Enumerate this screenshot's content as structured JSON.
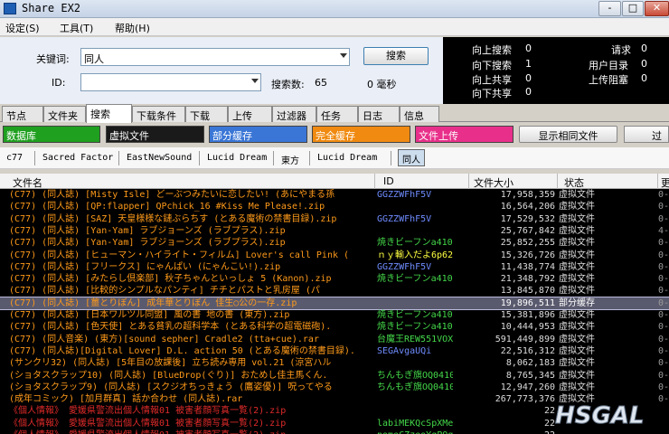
{
  "window": {
    "title": "Share EX2",
    "minimize": "-",
    "maximize": "□",
    "close": "✕"
  },
  "menu": [
    {
      "label": "设定(S)"
    },
    {
      "label": "工具(T)"
    },
    {
      "label": "帮助(H)"
    }
  ],
  "search": {
    "keyword_label": "关键词:",
    "keyword_value": "同人",
    "id_label": "ID:",
    "id_value": "",
    "search_button": "搜索",
    "result_count_label": "搜索数:",
    "result_count": "65",
    "elapsed": "0 毫秒"
  },
  "stats": [
    {
      "label": "向上搜索",
      "value": "0"
    },
    {
      "label": "向下搜索",
      "value": "1"
    },
    {
      "label": "向上共享",
      "value": "0"
    },
    {
      "label": "向下共享",
      "value": "0"
    },
    {
      "label": "请求",
      "value": "0"
    },
    {
      "label": "用户目录",
      "value": "0"
    },
    {
      "label": "上传阻塞",
      "value": "0"
    }
  ],
  "tabs": [
    {
      "label": "节点"
    },
    {
      "label": "文件夹"
    },
    {
      "label": "搜索"
    },
    {
      "label": "下载条件"
    },
    {
      "label": "下载"
    },
    {
      "label": "上传"
    },
    {
      "label": "过滤器"
    },
    {
      "label": "任务"
    },
    {
      "label": "日志"
    },
    {
      "label": "信息"
    }
  ],
  "filters": [
    {
      "label": "数据库",
      "color": "#1fa01f",
      "text": "#ffffff"
    },
    {
      "label": "虚拟文件",
      "color": "#1a1a1a",
      "text": "#ffffff"
    },
    {
      "label": "部分缓存",
      "color": "#3a76d6",
      "text": "#ffffff"
    },
    {
      "label": "完全缓存",
      "color": "#f08a10",
      "text": "#ffffff"
    },
    {
      "label": "文件上传",
      "color": "#e8308a",
      "text": "#ffffff"
    }
  ],
  "show_same_button": "显示相同文件",
  "overflow_button": "过",
  "tags": [
    "c77",
    "Sacred Factor",
    "EastNewSound",
    "Lucid Dream",
    "東方",
    "Lucid Dream"
  ],
  "active_tag": "同人",
  "columns": {
    "name": "文件名",
    "id": "ID",
    "size": "文件大小",
    "status": "状态",
    "extra": "更"
  },
  "rows": [
    {
      "name": "(C77) (同人誌) [Misty Isle] どーぶつみたいに恋したい! (あにやまる孫",
      "id": "GGZZWFhF5V",
      "size": "17,958,359",
      "status": "虚拟文件",
      "extra": "0-0",
      "color": "#ff9a1a",
      "id_color": "#6f8cff"
    },
    {
      "name": "(C77) (同人誌) [QP:flapper] QPchick_16 #Kiss Me Please!.zip",
      "id": "",
      "size": "16,564,206",
      "status": "虚拟文件",
      "extra": "0-0",
      "color": "#ff9a1a",
      "id_color": "#6f8cff"
    },
    {
      "name": "(C77) (同人誌) [SAZ] 天皇様様な鏈ぶらちす (とある魔術の禁書目録).zip",
      "id": "GGZZWFhF5V",
      "size": "17,529,532",
      "status": "虚拟文件",
      "extra": "0-0",
      "color": "#ff9a1a",
      "id_color": "#6f8cff"
    },
    {
      "name": "(C77) (同人誌) [Yan-Yam] ラブジョーンズ (ラブプラス).zip",
      "id": "",
      "size": "25,767,842",
      "status": "虚拟文件",
      "extra": "4-0",
      "color": "#ff9a1a",
      "id_color": "#6f8cff"
    },
    {
      "name": "(C77) (同人誌) [Yan-Yam] ラブジョーンズ (ラブプラス).zip",
      "id": "焼きビーフンa410",
      "size": "25,852,255",
      "status": "虚拟文件",
      "extra": "0-0",
      "color": "#ff9a1a",
      "id_color": "#44d84a"
    },
    {
      "name": "(C77) (同人誌) [ヒューマン・ハイライト・フィルム] Lover's call Pink (",
      "id": "ｎｙ輸入だよ6p62",
      "size": "15,326,726",
      "status": "虚拟文件",
      "extra": "0-0",
      "color": "#ff9a1a",
      "id_color": "#ffff40"
    },
    {
      "name": "(C77) (同人誌) [フリークス] にゃんぱい (にゃんこい!).zip",
      "id": "GGZZWFhF5V",
      "size": "11,438,774",
      "status": "虚拟文件",
      "extra": "0-0",
      "color": "#ff9a1a",
      "id_color": "#6f8cff"
    },
    {
      "name": "(C77) (同人誌) [みたらし倶楽部] 秋子ちゃんといっしょ 5 (Kanon).zip",
      "id": "焼きビーフンa410",
      "size": "21,348,792",
      "status": "虚拟文件",
      "extra": "0-0",
      "color": "#ff9a1a",
      "id_color": "#44d84a"
    },
    {
      "name": "(C77) (同人誌) [比較的シンプルなパンティ] チチとパストと乳房屋 (パ",
      "id": "",
      "size": "13,845,870",
      "status": "虚拟文件",
      "extra": "0-0",
      "color": "#ff9a1a",
      "id_color": "#6f8cff"
    },
    {
      "name": "(C77) (同人誌) [薑とりぼん] 成年華とりぼん 佳生○公の一存.zip",
      "id": "",
      "size": "19,896,511",
      "status": "部分缓存",
      "extra": "0-0",
      "color": "#ff9a1a",
      "id_color": "#6f8cff",
      "selected": true
    },
    {
      "name": "(C77) (同人誌) [日本ワルツル同盟] 風の書 地の書 (東方).zip",
      "id": "焼きビーフンa410",
      "size": "15,381,896",
      "status": "虚拟文件",
      "extra": "0-0",
      "color": "#ff9a1a",
      "id_color": "#44d84a"
    },
    {
      "name": "(C77) (同人誌) [色天使] とある貧乳の超科学本 (とある科学の超電磁砲).",
      "id": "焼きビーフンa410",
      "size": "10,444,953",
      "status": "虚拟文件",
      "extra": "0-0",
      "color": "#ff9a1a",
      "id_color": "#44d84a"
    },
    {
      "name": "(C77) (同人音楽) (東方)[sound sepher] Cradle2 (tta+cue).rar",
      "id": "台魔王REW551VOXZ",
      "size": "591,449,899",
      "status": "虚拟文件",
      "extra": "0-0",
      "color": "#ff9a1a",
      "id_color": "#44d84a"
    },
    {
      "name": "(C77) (同人誌)[Digital Lover] D.L. action 50 (とある魔術の禁書目録).",
      "id": "SEGAvgaUQi",
      "size": "22,516,312",
      "status": "虚拟文件",
      "extra": "0-0",
      "color": "#ff9a1a",
      "id_color": "#6f8cff"
    },
    {
      "name": "(サンクリ32) (同人誌) [5年目の放課後] 立ち読み専用 vol.21 (涼宮ハル",
      "id": "",
      "size": "8,062,183",
      "status": "虚拟文件",
      "extra": "0-0",
      "color": "#ff9a1a",
      "id_color": "#6f8cff"
    },
    {
      "name": "(ショタスクラップ10) (同人誌) [BlueDrop(ぐり)] おためし佳主馬くん.",
      "id": "ちんもぎ旗OQ0410",
      "size": "8,765,345",
      "status": "虚拟文件",
      "extra": "0-0",
      "color": "#ff9a1a",
      "id_color": "#44d84a"
    },
    {
      "name": "(ショタスクラップ9) (同人誌) [スクジオちっきょう (鷹姿優)] 呪ってやる",
      "id": "ちんもぎ旗OQ0410",
      "size": "12,947,260",
      "status": "虚拟文件",
      "extra": "0-0",
      "color": "#ff9a1a",
      "id_color": "#44d84a"
    },
    {
      "name": "(成年コミック) [加月群真] 話か合わせ (同人誌).rar",
      "id": "",
      "size": "267,773,376",
      "status": "虚拟文件",
      "extra": "0-0",
      "color": "#ff9a1a",
      "id_color": "#6f8cff"
    },
    {
      "name": "《個人情報》 愛媛県警流出個人情報01 被害者顔写真一覧(2).zip",
      "id": "",
      "size": "22",
      "status": "",
      "extra": "",
      "color": "#e02a2a",
      "id_color": "#6f8cff"
    },
    {
      "name": "《個人情報》 愛媛県警流出個人情報01 被害者顔写真一覧(2).zip",
      "id": "labiMEKQcSpXMe",
      "size": "22",
      "status": "",
      "extra": "",
      "color": "#e02a2a",
      "id_color": "#44d84a"
    },
    {
      "name": "《個人情報》 愛媛県警流出個人情報01 被害者顔写真一覧(2).zip",
      "id": "nomeCZzeoYqPQq",
      "size": "22",
      "status": "",
      "extra": "",
      "color": "#e02a2a",
      "id_color": "#44d84a"
    }
  ],
  "watermark_text": "HSGAL"
}
